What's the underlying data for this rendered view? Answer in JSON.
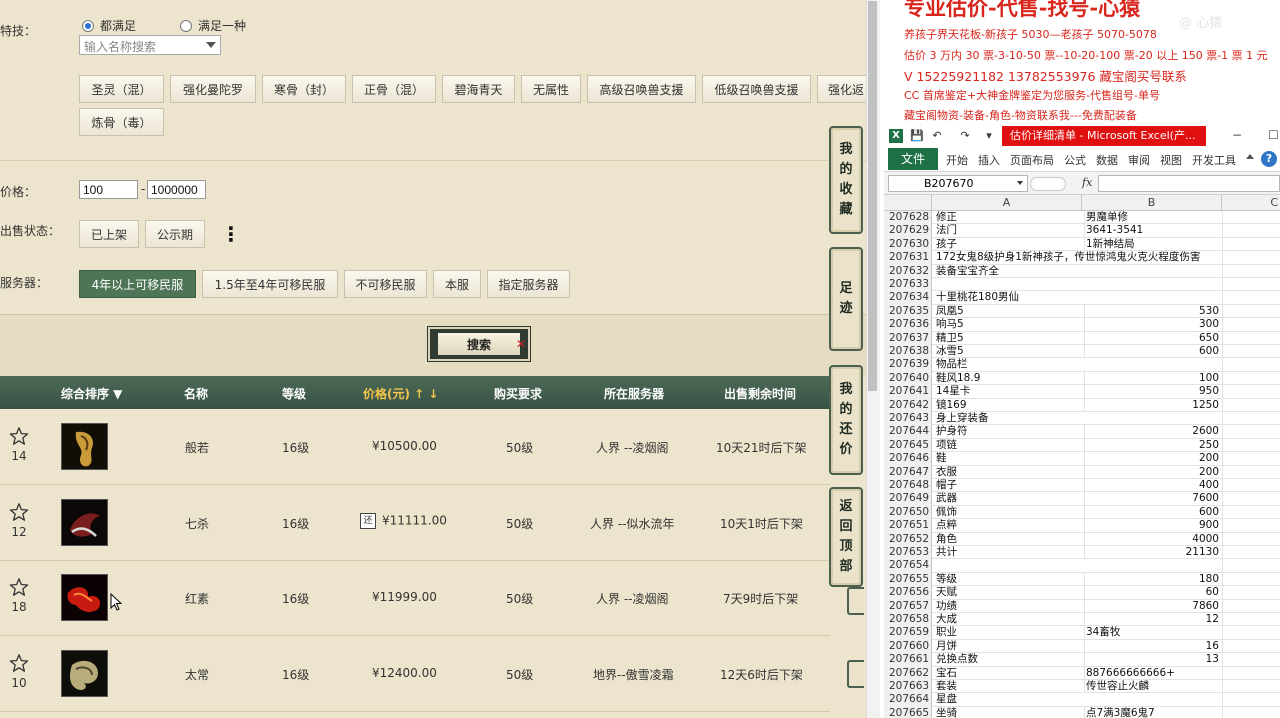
{
  "filters": {
    "skill_label": "特技：",
    "radio_all": "都满足",
    "radio_any": "满足一种",
    "skill_placeholder": "输入名称搜索",
    "skills": [
      "圣灵（混）",
      "强化曼陀罗",
      "寒骨（封）",
      "正骨（混）",
      "碧海青天",
      "无属性",
      "高级召唤兽支援",
      "低级召唤兽支援",
      "强化返",
      "炼骨（毒）"
    ],
    "price_label": "价格：",
    "price_min": "100",
    "price_max": "1000000",
    "price_dash": "-",
    "status_label": "出售状态：",
    "status_options": [
      "已上架",
      "公示期"
    ],
    "more_icon": "⋮",
    "server_label": "服务器：",
    "server_options": [
      "4年以上可移民服",
      "1.5年至4年可移民服",
      "不可移民服",
      "本服",
      "指定服务器"
    ],
    "search_button": "搜索"
  },
  "table": {
    "headers": [
      "综合排序 ▼",
      "名称",
      "等级",
      "价格(元)",
      "购买要求",
      "所在服务器",
      "出售剩余时间"
    ],
    "price_sort_arrows": "↑ ↓",
    "bargain_badge": "还",
    "rows": [
      {
        "rank": "14",
        "name": "般若",
        "level": "16级",
        "price": "¥10500.00",
        "bargain": false,
        "req": "50级",
        "server": "人界 --凌烟阁",
        "time": "10天21时后下架"
      },
      {
        "rank": "12",
        "name": "七杀",
        "level": "16级",
        "price": "¥11111.00",
        "bargain": true,
        "req": "50级",
        "server": "人界 --似水流年",
        "time": "10天1时后下架"
      },
      {
        "rank": "18",
        "name": "红素",
        "level": "16级",
        "price": "¥11999.00",
        "bargain": false,
        "req": "50级",
        "server": "人界 --凌烟阁",
        "time": "7天9时后下架"
      },
      {
        "rank": "10",
        "name": "太常",
        "level": "16级",
        "price": "¥12400.00",
        "bargain": false,
        "req": "50级",
        "server": "地界--傲雪凌霜",
        "time": "12天6时后下架"
      }
    ]
  },
  "side_tabs": [
    "我的收藏",
    "足迹",
    "我的还价",
    "返回顶部"
  ],
  "notes": {
    "headline": "专业估价-代售-找号-心猿",
    "watermark": "@ 心猿",
    "lines": [
      "养孩子界天花板-新孩子 5030—老孩子 5070-5078",
      "估价 3 万内 30 票-3-10-50 票--10-20-100 票-20 以上 150 票-1 票 1 元",
      "V 15225921182      13782553976    藏宝阁买号联系",
      "CC 首席鉴定+大神金牌鉴定为您服务-代售组号-单号",
      "藏宝阁物资-装备-角色-物资联系我---免费配装备"
    ]
  },
  "excel": {
    "app_icon": "X",
    "quick_access": [
      "💾",
      "↶",
      "↷",
      "▾"
    ],
    "doc_title": "估价详细清单 - Microsoft Excel(产...",
    "window_controls": [
      "−",
      "☐"
    ],
    "file_tab": "文件",
    "tabs": [
      "开始",
      "插入",
      "页面布局",
      "公式",
      "数据",
      "审阅",
      "视图",
      "开发工具"
    ],
    "help": "?",
    "name_box": "B207670",
    "fx": "fx",
    "columns": [
      "A",
      "B",
      "C"
    ],
    "rows": [
      {
        "n": "207628",
        "a": "修正",
        "b": "男魔单修",
        "num": false
      },
      {
        "n": "207629",
        "a": "法门",
        "b": "3641-3541",
        "num": false
      },
      {
        "n": "207630",
        "a": "孩子",
        "b": "1新神结局",
        "num": false
      },
      {
        "n": "207631",
        "a": "172女鬼8级护身1新神孩子，传世惊鸿鬼火克火程度伤害",
        "b": "",
        "num": false
      },
      {
        "n": "207632",
        "a": "装备宝宝齐全",
        "b": "",
        "num": false
      },
      {
        "n": "207633",
        "a": "",
        "b": "",
        "num": false
      },
      {
        "n": "207634",
        "a": "十里桃花180男仙",
        "b": "",
        "num": false
      },
      {
        "n": "207635",
        "a": "凤凰5",
        "b": "530",
        "num": true
      },
      {
        "n": "207636",
        "a": "响马5",
        "b": "300",
        "num": true
      },
      {
        "n": "207637",
        "a": "精卫5",
        "b": "650",
        "num": true
      },
      {
        "n": "207638",
        "a": "冰雪5",
        "b": "600",
        "num": true
      },
      {
        "n": "207639",
        "a": "物品栏",
        "b": "",
        "num": false
      },
      {
        "n": "207640",
        "a": "鞋风18.9",
        "b": "100",
        "num": true
      },
      {
        "n": "207641",
        "a": "14星卡",
        "b": "950",
        "num": true
      },
      {
        "n": "207642",
        "a": "镜169",
        "b": "1250",
        "num": true
      },
      {
        "n": "207643",
        "a": "身上穿装备",
        "b": "",
        "num": false
      },
      {
        "n": "207644",
        "a": "护身符",
        "b": "2600",
        "num": true
      },
      {
        "n": "207645",
        "a": "项链",
        "b": "250",
        "num": true
      },
      {
        "n": "207646",
        "a": "鞋",
        "b": "200",
        "num": true
      },
      {
        "n": "207647",
        "a": "衣服",
        "b": "200",
        "num": true
      },
      {
        "n": "207648",
        "a": "帽子",
        "b": "400",
        "num": true
      },
      {
        "n": "207649",
        "a": "武器",
        "b": "7600",
        "num": true
      },
      {
        "n": "207650",
        "a": "佩饰",
        "b": "600",
        "num": true
      },
      {
        "n": "207651",
        "a": "点粹",
        "b": "900",
        "num": true
      },
      {
        "n": "207652",
        "a": "角色",
        "b": "4000",
        "num": true
      },
      {
        "n": "207653",
        "a": "共计",
        "b": "21130",
        "num": true
      },
      {
        "n": "207654",
        "a": "",
        "b": "",
        "num": false
      },
      {
        "n": "207655",
        "a": "等级",
        "b": "180",
        "num": true
      },
      {
        "n": "207656",
        "a": "天赋",
        "b": "60",
        "num": true
      },
      {
        "n": "207657",
        "a": "功绩",
        "b": "7860",
        "num": true
      },
      {
        "n": "207658",
        "a": "大成",
        "b": "12",
        "num": true
      },
      {
        "n": "207659",
        "a": "职业",
        "b": "34畜牧",
        "num": false
      },
      {
        "n": "207660",
        "a": "月饼",
        "b": "16",
        "num": true
      },
      {
        "n": "207661",
        "a": "兑换点数",
        "b": "13",
        "num": true
      },
      {
        "n": "207662",
        "a": "宝石",
        "b": "887666666666+",
        "num": false
      },
      {
        "n": "207663",
        "a": "套装",
        "b": "传世容止火麟",
        "num": false
      },
      {
        "n": "207664",
        "a": "星盘",
        "b": "",
        "num": false
      },
      {
        "n": "207665",
        "a": "坐骑",
        "b": "点7满3魔6鬼7",
        "num": false
      }
    ]
  },
  "colors": {
    "accent_green": "#4d7556",
    "header_green": "#395244",
    "excel_green": "#1e7145",
    "note_red": "#d8261d",
    "title_red": "#e01010",
    "price_gold": "#f2c54a"
  }
}
